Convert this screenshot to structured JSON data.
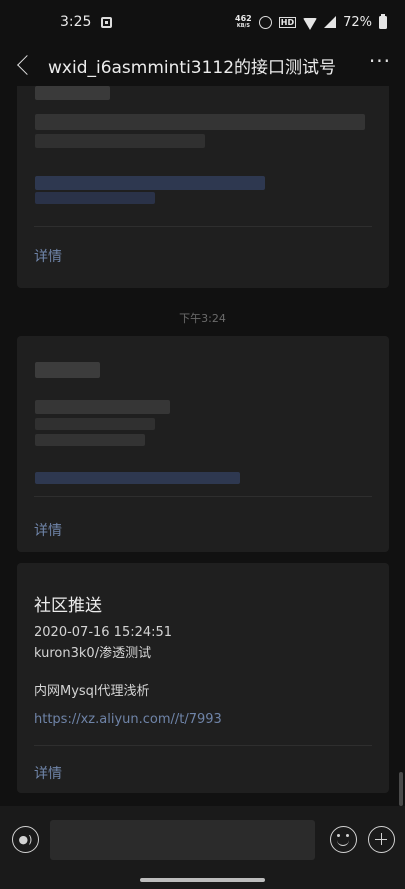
{
  "status_bar": {
    "time": "3:25",
    "net_speed_value": "462",
    "net_speed_unit": "KB/S",
    "hd_label": "HD",
    "battery_percent": "72%"
  },
  "nav": {
    "title": "wxid_i6asmminti3112的接口测试号",
    "more_label": "···"
  },
  "messages": [
    {
      "type": "template",
      "detail_label": "详情"
    },
    {
      "type": "timestamp",
      "text": "下午3:24"
    },
    {
      "type": "template",
      "detail_label": "详情"
    },
    {
      "type": "push",
      "title": "社区推送",
      "date": "2020-07-16 15:24:51",
      "author": "kuron3k0/渗透测试",
      "subject": "内网Mysql代理浅析",
      "link": "https://xz.aliyun.com//t/7993",
      "detail_label": "详情"
    }
  ],
  "input_bar": {
    "voice_icon": "voice-icon",
    "emoji_icon": "emoji-icon",
    "plus_icon": "plus-icon"
  },
  "colors": {
    "background": "#111111",
    "card": "#1f1f1f",
    "link": "#6f84a8"
  }
}
